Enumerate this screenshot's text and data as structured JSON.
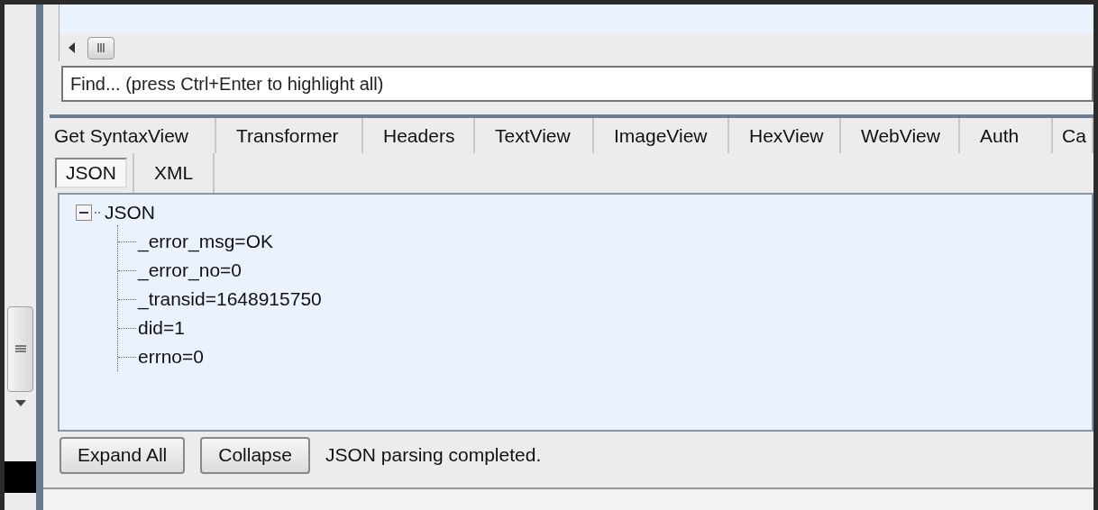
{
  "find": {
    "placeholder": "Find... (press Ctrl+Enter to highlight all)"
  },
  "tabs": [
    {
      "label": "Get SyntaxView",
      "selected": false
    },
    {
      "label": "Transformer",
      "selected": false
    },
    {
      "label": "Headers",
      "selected": false
    },
    {
      "label": "TextView",
      "selected": false
    },
    {
      "label": "ImageView",
      "selected": false
    },
    {
      "label": "HexView",
      "selected": false
    },
    {
      "label": "WebView",
      "selected": false
    },
    {
      "label": "Auth",
      "selected": false
    },
    {
      "label": "Ca",
      "selected": false
    }
  ],
  "subtabs": [
    {
      "label": "JSON",
      "selected": true
    },
    {
      "label": "XML",
      "selected": false
    }
  ],
  "tree": {
    "label": "JSON",
    "expanded": true,
    "children": [
      {
        "label": "_error_msg=OK"
      },
      {
        "label": "_error_no=0"
      },
      {
        "label": "_transid=1648915750"
      },
      {
        "label": "did=1"
      },
      {
        "label": "errno=0"
      }
    ]
  },
  "buttons": [
    "Expand All",
    "Collapse"
  ],
  "status": "JSON parsing completed."
}
